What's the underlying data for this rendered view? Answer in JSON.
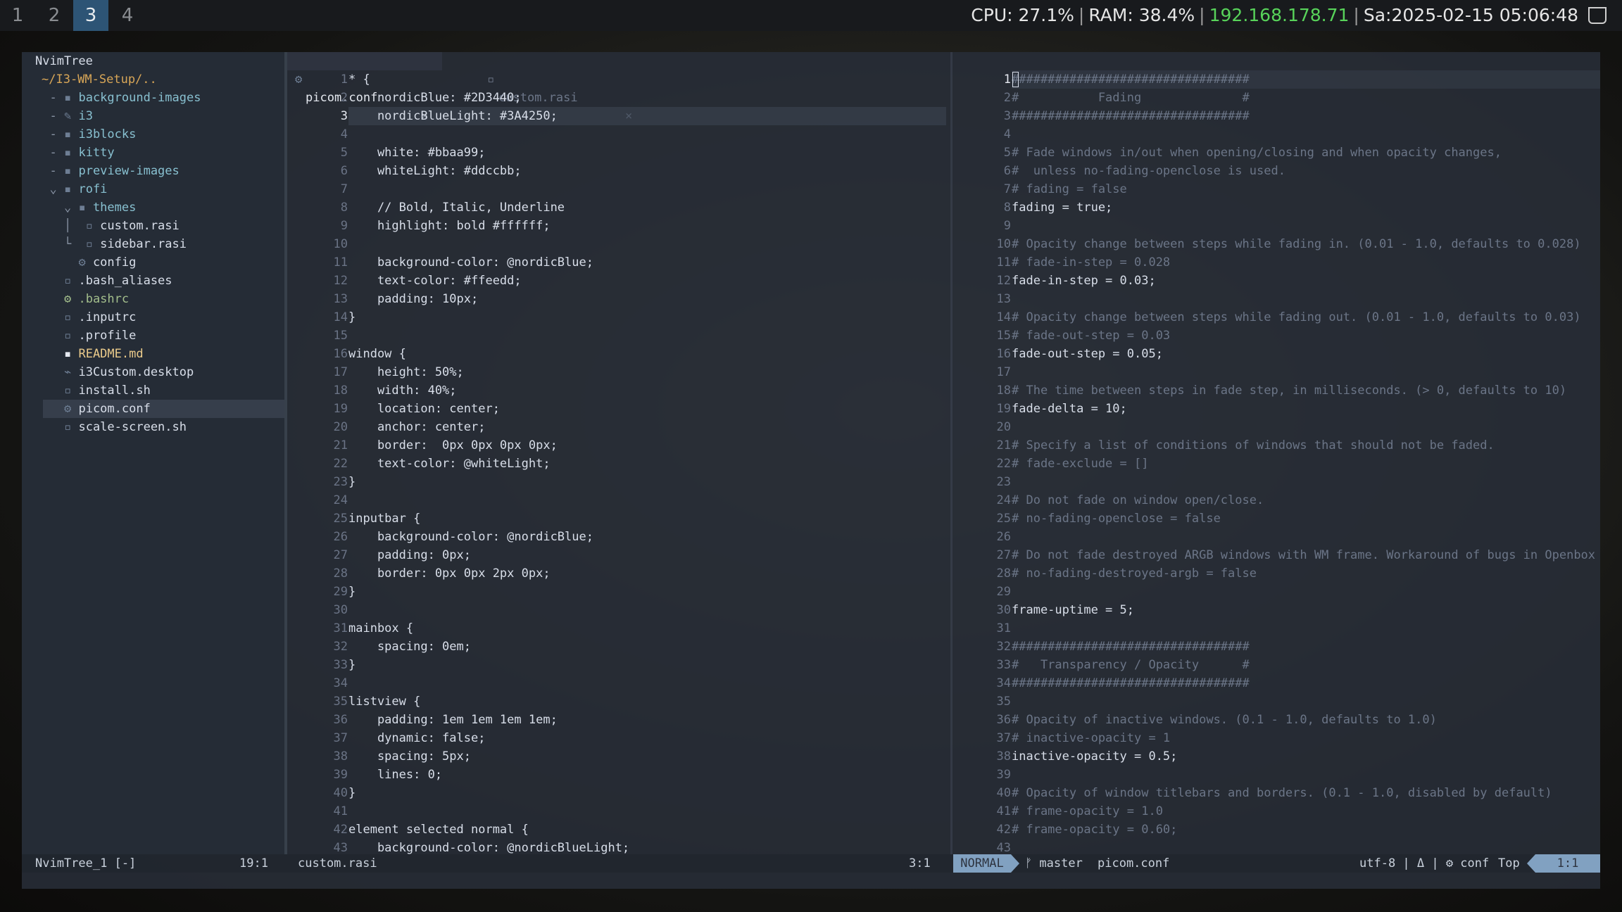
{
  "bar": {
    "workspaces": [
      "1",
      "2",
      "3",
      "4"
    ],
    "cpu": "CPU: 27.1%",
    "ram": "RAM: 38.4%",
    "ip": "192.168.178.71",
    "datetime": "Sa:2025-02-15 05:06:48",
    "sep": "|"
  },
  "tree": {
    "title": "NvimTree",
    "root": "~/I3-WM-Setup/..",
    "items": [
      {
        "prefix": "  -",
        "icon": "▪",
        "label": "background-images",
        "kind": "dir"
      },
      {
        "prefix": "  -",
        "icon": "✎",
        "label": "i3",
        "kind": "dir"
      },
      {
        "prefix": "  -",
        "icon": "▪",
        "label": "i3blocks",
        "kind": "dir"
      },
      {
        "prefix": "  -",
        "icon": "▪",
        "label": "kitty",
        "kind": "dir"
      },
      {
        "prefix": "  -",
        "icon": "▪",
        "label": "preview-images",
        "kind": "dir"
      },
      {
        "prefix": "  ⌄",
        "icon": "▪",
        "label": "rofi",
        "kind": "dir"
      },
      {
        "prefix": "    ⌄",
        "icon": "▪",
        "label": "themes",
        "kind": "dir"
      },
      {
        "prefix": "    │ ",
        "icon": "▫",
        "label": "custom.rasi",
        "kind": "file"
      },
      {
        "prefix": "    └ ",
        "icon": "▫",
        "label": "sidebar.rasi",
        "kind": "file"
      },
      {
        "prefix": "     ",
        "icon": "⚙",
        "label": "config",
        "kind": "file"
      },
      {
        "prefix": "   ",
        "icon": "▫",
        "label": ".bash_aliases",
        "kind": "file"
      },
      {
        "prefix": "   ",
        "icon": "⚙",
        "label": ".bashrc",
        "kind": "exec"
      },
      {
        "prefix": "   ",
        "icon": "▫",
        "label": ".inputrc",
        "kind": "file"
      },
      {
        "prefix": "   ",
        "icon": "▫",
        "label": ".profile",
        "kind": "file"
      },
      {
        "prefix": "   ",
        "icon": "▪",
        "label": "README.md",
        "kind": "md"
      },
      {
        "prefix": "   ",
        "icon": "⌁",
        "label": "i3Custom.desktop",
        "kind": "file"
      },
      {
        "prefix": "   ",
        "icon": "▫",
        "label": "install.sh",
        "kind": "file"
      },
      {
        "prefix": "   ",
        "icon": "⚙",
        "label": "picom.conf",
        "kind": "file"
      },
      {
        "prefix": "   ",
        "icon": "▫",
        "label": "scale-screen.sh",
        "kind": "file"
      }
    ]
  },
  "tabs": [
    {
      "icon": "⚙",
      "label": "picom.conf",
      "close": "×"
    },
    {
      "icon": "▫",
      "label": "custom.rasi",
      "close": "×"
    }
  ],
  "left_editor": {
    "current_line": 3,
    "lines": [
      "* {",
      "    nordicBlue: #2D3440;",
      "    nordicBlueLight: #3A4250;",
      "",
      "    white: #bbaa99;",
      "    whiteLight: #ddccbb;",
      "",
      "    // Bold, Italic, Underline",
      "    highlight: bold #ffffff;",
      "",
      "    background-color: @nordicBlue;",
      "    text-color: #ffeedd;",
      "    padding: 10px;",
      "}",
      "",
      "window {",
      "    height: 50%;",
      "    width: 40%;",
      "    location: center;",
      "    anchor: center;",
      "    border:  0px 0px 0px 0px;",
      "    text-color: @whiteLight;",
      "}",
      "",
      "inputbar {",
      "    background-color: @nordicBlue;",
      "    padding: 0px;",
      "    border: 0px 0px 2px 0px;",
      "}",
      "",
      "mainbox {",
      "    spacing: 0em;",
      "}",
      "",
      "listview {",
      "    padding: 1em 1em 1em 1em;",
      "    dynamic: false;",
      "    spacing: 5px;",
      "    lines: 0;",
      "}",
      "",
      "element selected normal {",
      "    background-color: @nordicBlueLight;"
    ]
  },
  "right_editor": {
    "current_line": 1,
    "lines": [
      "#################################",
      "#           Fading              #",
      "#################################",
      "",
      "# Fade windows in/out when opening/closing and when opacity changes,",
      "#  unless no-fading-openclose is used.",
      "# fading = false",
      "fading = true;",
      "",
      "# Opacity change between steps while fading in. (0.01 - 1.0, defaults to 0.028)",
      "# fade-in-step = 0.028",
      "fade-in-step = 0.03;",
      "",
      "# Opacity change between steps while fading out. (0.01 - 1.0, defaults to 0.03)",
      "# fade-out-step = 0.03",
      "fade-out-step = 0.05;",
      "",
      "# The time between steps in fade step, in milliseconds. (> 0, defaults to 10)",
      "fade-delta = 10;",
      "",
      "# Specify a list of conditions of windows that should not be faded.",
      "# fade-exclude = []",
      "",
      "# Do not fade on window open/close.",
      "# no-fading-openclose = false",
      "",
      "# Do not fade destroyed ARGB windows with WM frame. Workaround of bugs in Openbox",
      "# no-fading-destroyed-argb = false",
      "",
      "frame-uptime = 5;",
      "",
      "#################################",
      "#   Transparency / Opacity      #",
      "#################################",
      "",
      "# Opacity of inactive windows. (0.1 - 1.0, defaults to 1.0)",
      "# inactive-opacity = 1",
      "inactive-opacity = 0.5;",
      "",
      "# Opacity of window titlebars and borders. (0.1 - 1.0, disabled by default)",
      "# frame-opacity = 1.0",
      "# frame-opacity = 0.60;",
      ""
    ]
  },
  "statusline": {
    "tree_name": "NvimTree_1 [-]",
    "tree_pos": "19:1",
    "left_file": "custom.rasi",
    "left_pos": "3:1",
    "mode": "NORMAL",
    "branch": "ᚠ master",
    "right_file": "picom.conf",
    "encoding": "utf-8 | Δ | ⚙ conf",
    "scroll": "Top",
    "right_pos": "1:1"
  }
}
